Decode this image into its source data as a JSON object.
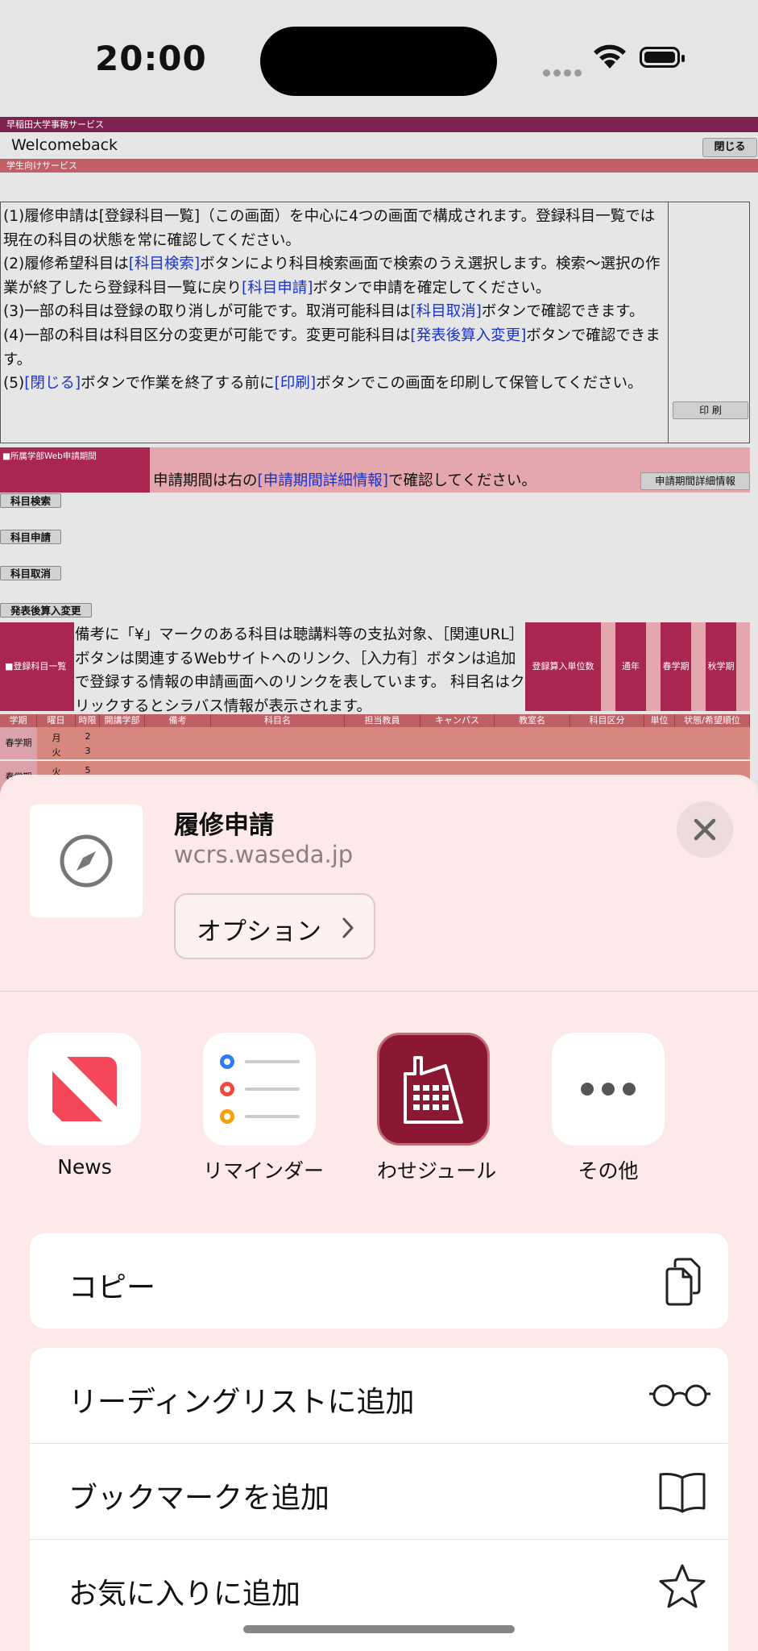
{
  "status": {
    "time": "20:00"
  },
  "web": {
    "top_bar": "早稲田大学事務サービス",
    "welcome": "Welcomeback",
    "close_button": "閉じる",
    "sub_bar": "学生向けサービス",
    "info_lines": [
      [
        "(1)履修申請は[登録科目一覧]（この画面）を中心に4つの画面で構成されます。登録科目一覧では現在の科目の状態を常に確認してください。"
      ],
      [
        "(2)履修希望科目は",
        "[科目検索]",
        "ボタンにより科目検索画面で検索のうえ選択します。検索～選択の作業が終了したら登録科目一覧に戻り",
        "[科目申請]",
        "ボタンで申請を確定してください。"
      ],
      [
        "(3)一部の科目は登録の取り消しが可能です。取消可能科目は",
        "[科目取消]",
        "ボタンで確認できます。"
      ],
      [
        "(4)一部の科目は科目区分の変更が可能です。変更可能科目は",
        "[発表後算入変更]",
        "ボタンで確認できます。"
      ],
      [
        "(5)",
        "[閉じる]",
        "ボタンで作業を終了する前に",
        "[印刷]",
        "ボタンでこの画面を印刷して保管してください。"
      ]
    ],
    "print_button": "印 刷",
    "period_label": "■所属学部Web申請期間",
    "period_text_pre": "申請期間は右の",
    "period_text_link": "[申請期間詳細情報]",
    "period_text_post": "で確認してください。",
    "period_button": "申請期間詳細情報",
    "buttons": [
      "科目検索",
      "科目申請",
      "科目取消",
      "発表後算入変更"
    ],
    "registered_label": "■登録科目一覧",
    "registered_note": "備考に「¥」マークのある科目は聴講料等の支払対象、［関連URL］ボタンは関連するWebサイトへのリンク、［入力有］ボタンは追加で登録する情報の申請画面へのリンクを表しています。 科目名はクリックするとシラバス情報が表示されます。",
    "credit_columns": [
      "登録算入単位数",
      "通年",
      "春学期",
      "秋学期"
    ],
    "table_headers": [
      "学期",
      "曜日",
      "時限",
      "開講学部",
      "備考",
      "科目名",
      "担当教員",
      "キャンパス",
      "教室名",
      "科目区分",
      "単位",
      "状態/希望順位"
    ],
    "table_rows": [
      {
        "term": "春学期",
        "days": [
          "月",
          "火"
        ],
        "periods": [
          "2",
          "3"
        ]
      },
      {
        "term": "春学期",
        "days": [
          "火"
        ],
        "periods": [
          "5"
        ]
      }
    ]
  },
  "share_sheet": {
    "title": "履修申請",
    "url": "wcrs.waseda.jp",
    "options_label": "オプション",
    "apps": [
      {
        "label": "News",
        "icon": "news-icon"
      },
      {
        "label": "リマインダー",
        "icon": "reminders-icon"
      },
      {
        "label": "わせジュール",
        "icon": "wasejule-icon"
      },
      {
        "label": "その他",
        "icon": "more-icon"
      }
    ],
    "actions": [
      {
        "label": "コピー",
        "icon": "copy-icon"
      },
      {
        "label": "リーディングリストに追加",
        "icon": "glasses-icon"
      },
      {
        "label": "ブックマークを追加",
        "icon": "book-icon"
      },
      {
        "label": "お気に入りに追加",
        "icon": "star-icon"
      }
    ]
  }
}
